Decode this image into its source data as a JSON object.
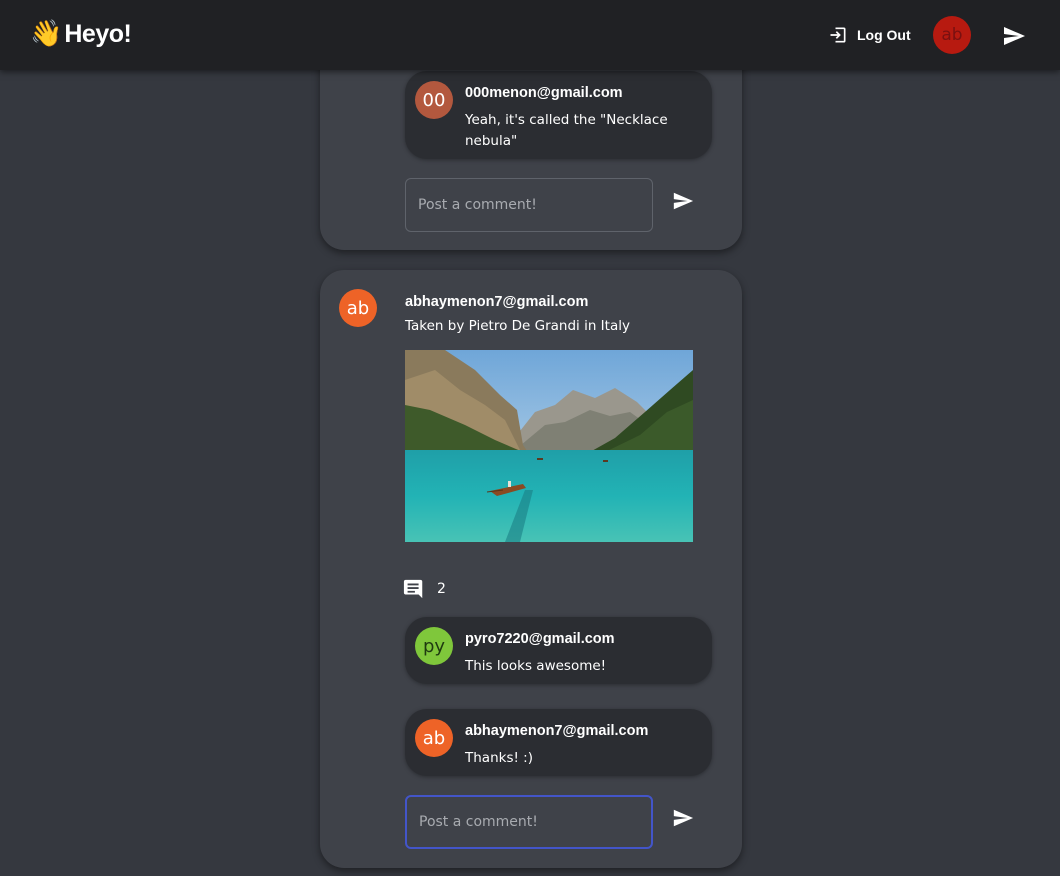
{
  "app": {
    "brand_emoji": "👋",
    "brand_name": "Heyo!"
  },
  "nav": {
    "logout_label": "Log Out",
    "user_initials": "ab",
    "user_avatar_color": "#b71a10",
    "icons": [
      "logout-icon",
      "send-icon"
    ]
  },
  "previous_post": {
    "comments": [
      {
        "initials": "00",
        "avatar_color": "#b3583e",
        "author": "000menon@gmail.com",
        "text": "Yeah, it's called the \"Necklace nebula\""
      }
    ],
    "comment_placeholder": "Post a comment!"
  },
  "post": {
    "initials": "ab",
    "avatar_color": "#ee6327",
    "author": "abhaymenon7@gmail.com",
    "caption": "Taken by Pietro De Grandi in Italy",
    "image_alt": "Lake with rowboat surrounded by mountains",
    "comment_count": "2",
    "comments": [
      {
        "initials": "py",
        "avatar_color": "#7fc73b",
        "author": "pyro7220@gmail.com",
        "text": "This looks awesome!"
      },
      {
        "initials": "ab",
        "avatar_color": "#ee6327",
        "author": "abhaymenon7@gmail.com",
        "text": "Thanks! :)"
      }
    ],
    "comment_placeholder": "Post a comment!",
    "focus_color": "#4355c9"
  },
  "colors": {
    "background": "#35383f",
    "topbar": "#202124",
    "card": "#3f4249",
    "comment_bubble": "#2b2d32"
  }
}
